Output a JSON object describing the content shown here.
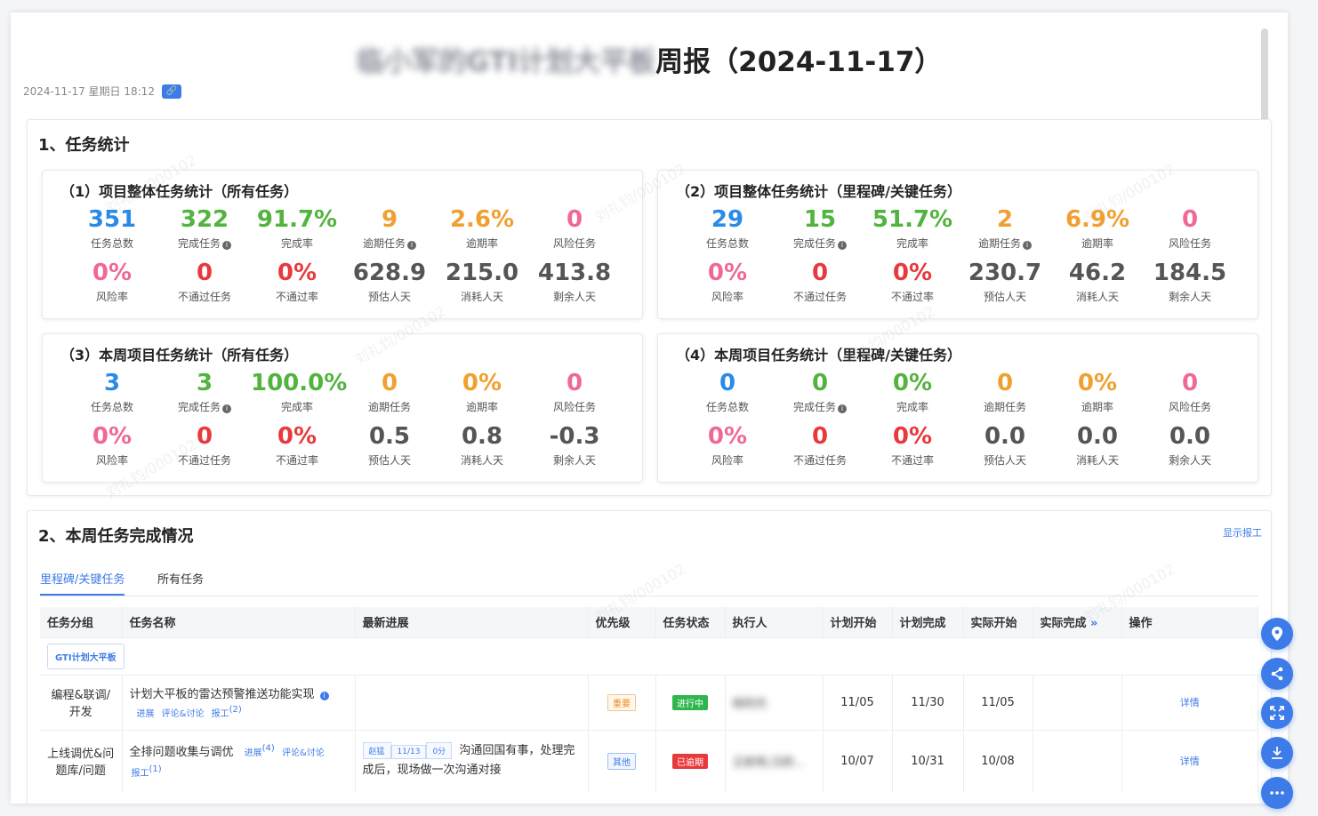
{
  "header": {
    "title_blurred": "临小军的GTI计划大平板",
    "title_suffix": "周报（2024-11-17）",
    "datetime": "2024-11-17 星期日 18:12",
    "link_icon": "link-icon"
  },
  "section1": {
    "title": "1、任务统计",
    "cards": [
      {
        "title": "（1）项目整体任务统计（所有任务）",
        "metrics": [
          {
            "value": "351",
            "label": "任务总数",
            "color": "#2a8be6"
          },
          {
            "value": "322",
            "label": "完成任务",
            "color": "#52b43e",
            "info": true
          },
          {
            "value": "91.7%",
            "label": "完成率",
            "color": "#52b43e"
          },
          {
            "value": "9",
            "label": "逾期任务",
            "color": "#f0a030",
            "info": true
          },
          {
            "value": "2.6%",
            "label": "逾期率",
            "color": "#f0a030"
          },
          {
            "value": "0",
            "label": "风险任务",
            "color": "#f06898"
          },
          {
            "value": "0%",
            "label": "风险率",
            "color": "#f06898"
          },
          {
            "value": "0",
            "label": "不通过任务",
            "color": "#e8393d"
          },
          {
            "value": "0%",
            "label": "不通过率",
            "color": "#e8393d"
          },
          {
            "value": "628.9",
            "label": "预估人天",
            "color": "#555555"
          },
          {
            "value": "215.0",
            "label": "消耗人天",
            "color": "#555555"
          },
          {
            "value": "413.8",
            "label": "剩余人天",
            "color": "#555555"
          }
        ]
      },
      {
        "title": "（2）项目整体任务统计（里程碑/关键任务）",
        "metrics": [
          {
            "value": "29",
            "label": "任务总数",
            "color": "#2a8be6"
          },
          {
            "value": "15",
            "label": "完成任务",
            "color": "#52b43e",
            "info": true
          },
          {
            "value": "51.7%",
            "label": "完成率",
            "color": "#52b43e"
          },
          {
            "value": "2",
            "label": "逾期任务",
            "color": "#f0a030",
            "info": true
          },
          {
            "value": "6.9%",
            "label": "逾期率",
            "color": "#f0a030"
          },
          {
            "value": "0",
            "label": "风险任务",
            "color": "#f06898"
          },
          {
            "value": "0%",
            "label": "风险率",
            "color": "#f06898"
          },
          {
            "value": "0",
            "label": "不通过任务",
            "color": "#e8393d"
          },
          {
            "value": "0%",
            "label": "不通过率",
            "color": "#e8393d"
          },
          {
            "value": "230.7",
            "label": "预估人天",
            "color": "#555555"
          },
          {
            "value": "46.2",
            "label": "消耗人天",
            "color": "#555555"
          },
          {
            "value": "184.5",
            "label": "剩余人天",
            "color": "#555555"
          }
        ]
      },
      {
        "title": "（3）本周项目任务统计（所有任务）",
        "metrics": [
          {
            "value": "3",
            "label": "任务总数",
            "color": "#2a8be6"
          },
          {
            "value": "3",
            "label": "完成任务",
            "color": "#52b43e",
            "info": true
          },
          {
            "value": "100.0%",
            "label": "完成率",
            "color": "#52b43e"
          },
          {
            "value": "0",
            "label": "逾期任务",
            "color": "#f0a030"
          },
          {
            "value": "0%",
            "label": "逾期率",
            "color": "#f0a030"
          },
          {
            "value": "0",
            "label": "风险任务",
            "color": "#f06898"
          },
          {
            "value": "0%",
            "label": "风险率",
            "color": "#f06898"
          },
          {
            "value": "0",
            "label": "不通过任务",
            "color": "#e8393d"
          },
          {
            "value": "0%",
            "label": "不通过率",
            "color": "#e8393d"
          },
          {
            "value": "0.5",
            "label": "预估人天",
            "color": "#555555"
          },
          {
            "value": "0.8",
            "label": "消耗人天",
            "color": "#555555"
          },
          {
            "value": "-0.3",
            "label": "剩余人天",
            "color": "#555555"
          }
        ]
      },
      {
        "title": "（4）本周项目任务统计（里程碑/关键任务）",
        "metrics": [
          {
            "value": "0",
            "label": "任务总数",
            "color": "#2a8be6"
          },
          {
            "value": "0",
            "label": "完成任务",
            "color": "#52b43e",
            "info": true
          },
          {
            "value": "0%",
            "label": "完成率",
            "color": "#52b43e"
          },
          {
            "value": "0",
            "label": "逾期任务",
            "color": "#f0a030"
          },
          {
            "value": "0%",
            "label": "逾期率",
            "color": "#f0a030"
          },
          {
            "value": "0",
            "label": "风险任务",
            "color": "#f06898"
          },
          {
            "value": "0%",
            "label": "风险率",
            "color": "#f06898"
          },
          {
            "value": "0",
            "label": "不通过任务",
            "color": "#e8393d"
          },
          {
            "value": "0%",
            "label": "不通过率",
            "color": "#e8393d"
          },
          {
            "value": "0.0",
            "label": "预估人天",
            "color": "#555555"
          },
          {
            "value": "0.0",
            "label": "消耗人天",
            "color": "#555555"
          },
          {
            "value": "0.0",
            "label": "剩余人天",
            "color": "#555555"
          }
        ]
      }
    ]
  },
  "section2": {
    "title": "2、本周任务完成情况",
    "show_work_label": "显示报工",
    "tabs": [
      "里程碑/关键任务",
      "所有任务"
    ],
    "columns": [
      "任务分组",
      "任务名称",
      "最新进展",
      "优先级",
      "任务状态",
      "执行人",
      "计划开始",
      "计划完成",
      "实际开始",
      "实际完成",
      "操作"
    ],
    "group_tag": "GTI计划大平板",
    "rows": [
      {
        "group": "编程&联调/开发",
        "name": "计划大平板的雷达预警推送功能实现",
        "links": [
          "进展",
          "评论&讨论",
          "报工"
        ],
        "link_sup": "(2)",
        "progress": "",
        "priority": "重要",
        "status": "进行中",
        "assignee": "杨阿杰",
        "plan_start": "11/05",
        "plan_end": "11/30",
        "actual_start": "11/05",
        "actual_end": "",
        "action": "详情"
      },
      {
        "group": "上线调优&问题库/问题",
        "name": "全排问题收集与调优",
        "links": [
          "进展",
          "评论&讨论",
          "报工"
        ],
        "sup_progress": "(4)",
        "link_sup": "(1)",
        "progress_chips": [
          "赵猛",
          "11/13",
          "0分"
        ],
        "progress": "沟通回国有事，处理完成后，现场做一次沟通对接",
        "priority": "其他",
        "status": "已逾期",
        "assignee": "王新明,冯桥...",
        "plan_start": "10/07",
        "plan_end": "10/31",
        "actual_start": "10/08",
        "actual_end": "",
        "action": "详情"
      }
    ]
  },
  "floating_buttons": [
    "location-icon",
    "share-icon",
    "fullscreen-icon",
    "download-icon",
    "more-icon"
  ],
  "watermark": "刘礼钧/000102"
}
